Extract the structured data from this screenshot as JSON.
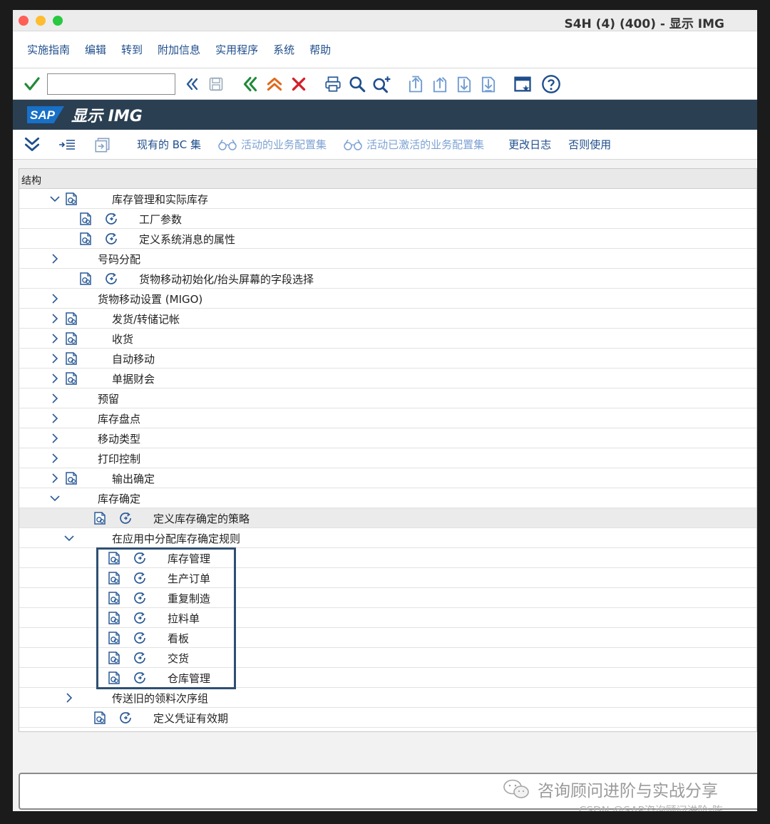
{
  "window": {
    "title": "S4H (4) (400) - 显示 IMG"
  },
  "menubar": {
    "items": [
      "实施指南",
      "编辑",
      "转到",
      "附加信息",
      "实用程序",
      "系统",
      "帮助"
    ]
  },
  "toolbar": {
    "command_value": "",
    "icons": [
      "check-icon",
      "back-arrows-icon",
      "save-icon",
      "back-icon",
      "exit-icon",
      "cancel-icon",
      "print-icon",
      "find-icon",
      "find-next-icon",
      "first-page-icon",
      "prev-page-icon",
      "next-page-icon",
      "last-page-icon",
      "layout-icon",
      "help-icon"
    ]
  },
  "header": {
    "logo": "SAP",
    "title": "显示 IMG"
  },
  "appbar": {
    "buttons": [
      "现有的 BC 集",
      "活动的业务配置集",
      "活动已激活的业务配置集",
      "更改日志",
      "否则使用"
    ]
  },
  "tree": {
    "header": "结构",
    "rows": [
      {
        "label": "库存管理和实际库存",
        "twisty": "open",
        "doc": true,
        "exec": false
      },
      {
        "label": "工厂参数",
        "twisty": "",
        "doc": true,
        "exec": true
      },
      {
        "label": "定义系统消息的属性",
        "twisty": "",
        "doc": true,
        "exec": true
      },
      {
        "label": "号码分配",
        "twisty": "closed",
        "doc": false,
        "exec": false
      },
      {
        "label": "货物移动初始化/抬头屏幕的字段选择",
        "twisty": "",
        "doc": true,
        "exec": true
      },
      {
        "label": "货物移动设置 (MIGO)",
        "twisty": "closed",
        "doc": false,
        "exec": false
      },
      {
        "label": "发货/转储记帐",
        "twisty": "closed",
        "doc": true,
        "exec": false
      },
      {
        "label": "收货",
        "twisty": "closed",
        "doc": true,
        "exec": false
      },
      {
        "label": "自动移动",
        "twisty": "closed",
        "doc": true,
        "exec": false
      },
      {
        "label": "单据财会",
        "twisty": "closed",
        "doc": true,
        "exec": false
      },
      {
        "label": "预留",
        "twisty": "closed",
        "doc": false,
        "exec": false
      },
      {
        "label": "库存盘点",
        "twisty": "closed",
        "doc": false,
        "exec": false
      },
      {
        "label": "移动类型",
        "twisty": "closed",
        "doc": false,
        "exec": false
      },
      {
        "label": "打印控制",
        "twisty": "closed",
        "doc": false,
        "exec": false
      },
      {
        "label": "输出确定",
        "twisty": "closed",
        "doc": true,
        "exec": false
      },
      {
        "label": "库存确定",
        "twisty": "open",
        "doc": false,
        "exec": false
      },
      {
        "label": "定义库存确定的策略",
        "twisty": "",
        "doc": true,
        "exec": true,
        "selected": true
      },
      {
        "label": "在应用中分配库存确定规则",
        "twisty": "open",
        "doc": false,
        "exec": false
      },
      {
        "label": "库存管理",
        "twisty": "",
        "doc": true,
        "exec": true
      },
      {
        "label": "生产订单",
        "twisty": "",
        "doc": true,
        "exec": true
      },
      {
        "label": "重复制造",
        "twisty": "",
        "doc": true,
        "exec": true
      },
      {
        "label": "拉料单",
        "twisty": "",
        "doc": true,
        "exec": true
      },
      {
        "label": "看板",
        "twisty": "",
        "doc": true,
        "exec": true
      },
      {
        "label": "交货",
        "twisty": "",
        "doc": true,
        "exec": true
      },
      {
        "label": "仓库管理",
        "twisty": "",
        "doc": true,
        "exec": true
      },
      {
        "label": "传送旧的领料次序组",
        "twisty": "closed",
        "doc": false,
        "exec": false
      },
      {
        "label": "定义凭证有效期",
        "twisty": "",
        "doc": true,
        "exec": true
      }
    ]
  },
  "watermark": {
    "wechat": "咨询顾问进阶与实战分享",
    "csdn": "CSDN @SAP咨询顾问进阶-陈"
  },
  "colors": {
    "sap_bar": "#2a3f52",
    "link": "#1f4e8c",
    "check": "#1f8a3a",
    "exit": "#e06a1b",
    "cancel": "#d3202a",
    "highlight": "#2e4f72"
  }
}
